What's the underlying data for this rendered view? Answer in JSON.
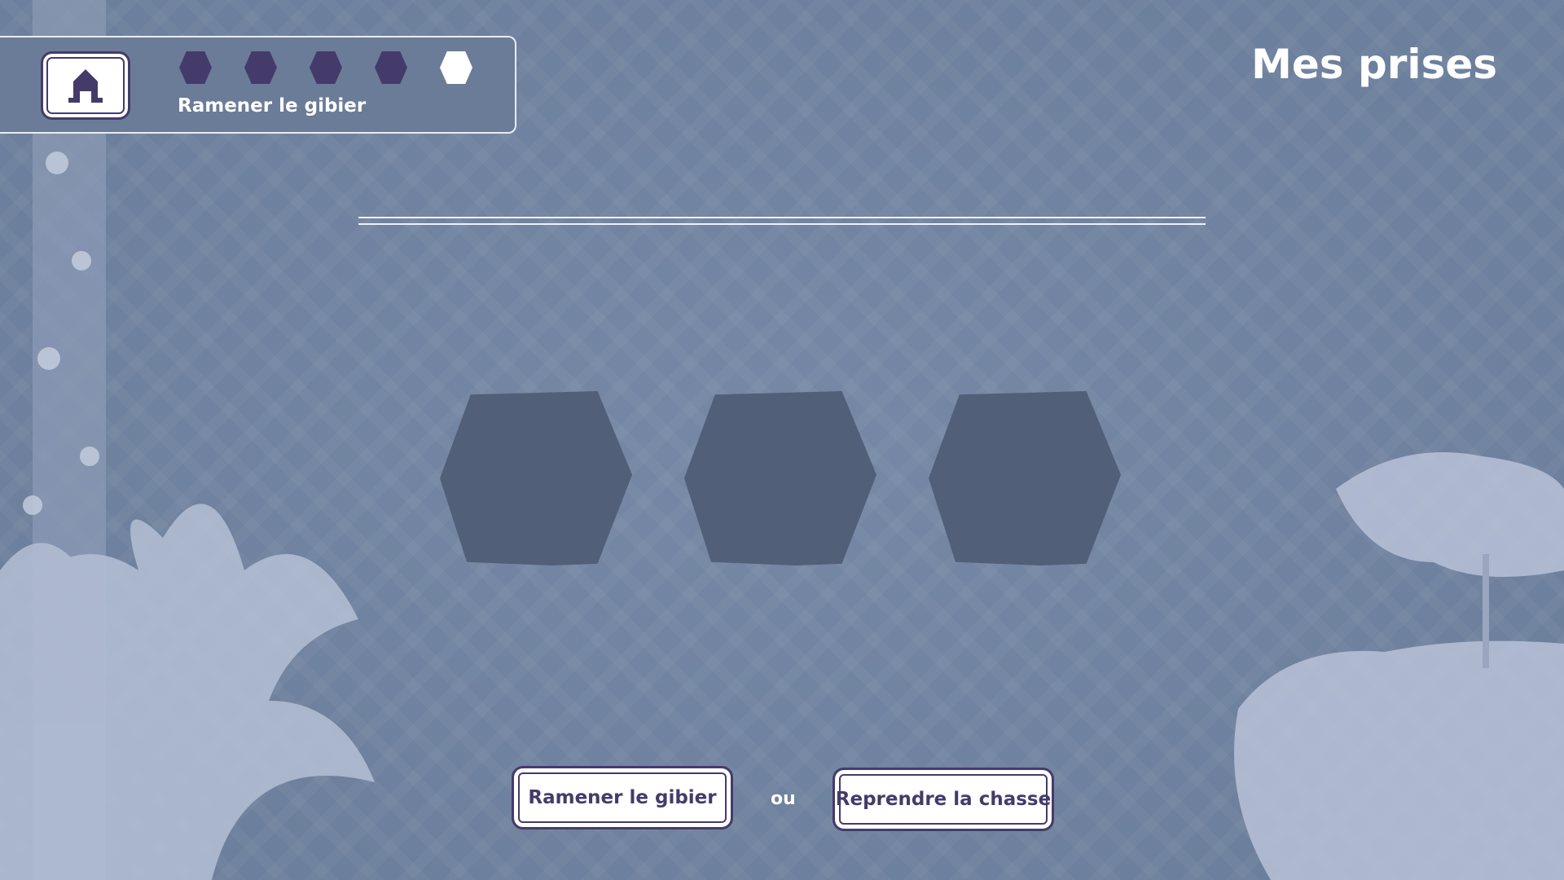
{
  "header": {
    "home_icon": "house-icon",
    "progress": {
      "total_steps": 5,
      "current_step": 5
    },
    "step_label": "Ramener le gibier",
    "title": "Mes prises"
  },
  "catches": {
    "slots": 3,
    "filled": 0
  },
  "actions": {
    "bring_back_label": "Ramener le gibier",
    "or_label": "ou",
    "resume_label": "Reprendre la chasse"
  },
  "colors": {
    "accent": "#453b6a",
    "background": "#6f82a0",
    "slot": "#515f79"
  }
}
